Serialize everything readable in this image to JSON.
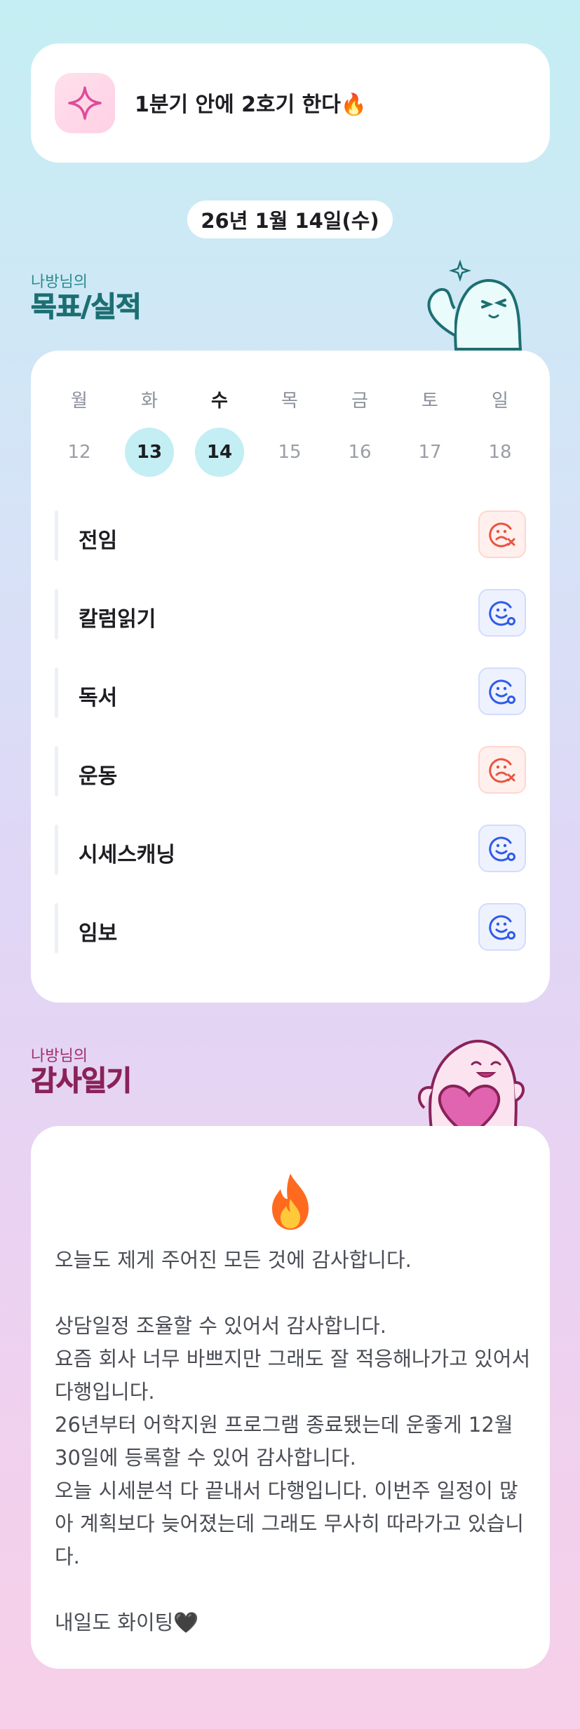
{
  "goal": {
    "text": "1분기 안에 2호기 한다🔥",
    "icon": "sparkle-icon"
  },
  "date_label": "26년 1월 14일(수)",
  "goals_section": {
    "prefix": "나방님의",
    "title": "목표/실적"
  },
  "week": {
    "days": [
      {
        "name": "월",
        "num": "12",
        "active": false,
        "today": false
      },
      {
        "name": "화",
        "num": "13",
        "active": true,
        "today": false
      },
      {
        "name": "수",
        "num": "14",
        "active": true,
        "today": true
      },
      {
        "name": "목",
        "num": "15",
        "active": false,
        "today": false
      },
      {
        "name": "금",
        "num": "16",
        "active": false,
        "today": false
      },
      {
        "name": "토",
        "num": "17",
        "active": false,
        "today": false
      },
      {
        "name": "일",
        "num": "18",
        "active": false,
        "today": false
      }
    ]
  },
  "goals": [
    {
      "label": "전임",
      "status": "fail",
      "color": "#e8553e"
    },
    {
      "label": "칼럼읽기",
      "status": "done",
      "color": "#2f5be8"
    },
    {
      "label": "독서",
      "status": "done",
      "color": "#2f5be8"
    },
    {
      "label": "운동",
      "status": "fail",
      "color": "#e8553e"
    },
    {
      "label": "시세스캐닝",
      "status": "done",
      "color": "#2f5be8"
    },
    {
      "label": "임보",
      "status": "done",
      "color": "#2f5be8"
    }
  ],
  "diary_section": {
    "prefix": "나방님의",
    "title": "감사일기"
  },
  "diary": {
    "icon": "fire-icon",
    "paragraphs": [
      "오늘도 제게 주어진 모든 것에 감사합니다.",
      "",
      "상담일정 조율할 수 있어서 감사합니다.",
      "요즘 회사 너무 바쁘지만 그래도 잘 적응해나가고 있어서 다행입니다.",
      "26년부터 어학지원 프로그램 종료됐는데 운좋게 12월 30일에 등록할 수 있어 감사합니다.",
      "오늘 시세분석 다 끝내서 다행입니다. 이번주 일정이 많아 계획보다 늦어졌는데 그래도 무사히 따라가고 있습니다.",
      "",
      "내일도 화이팅🖤"
    ]
  }
}
